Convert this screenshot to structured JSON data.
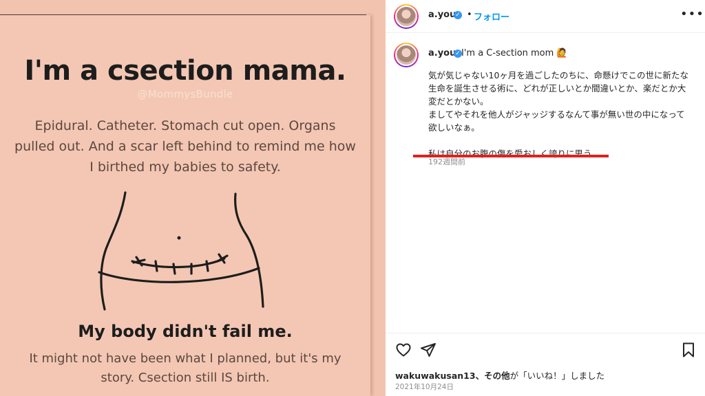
{
  "image": {
    "title": "I'm a csection mama.",
    "handle": "@MommysBundle",
    "body": "Epidural. Catheter. Stomach cut open. Organs pulled out. And a scar left behind to remind me how I birthed my babies to safety.",
    "tagline": "My body didn't fail me.",
    "footer": "It might not have been what I planned, but it's my story. Csection still IS birth."
  },
  "header": {
    "username": "a.you",
    "separator": "•",
    "follow_label": "フォロー",
    "more_icon": "ellipsis-icon"
  },
  "caption": {
    "username": "a.you",
    "title": "I'm a C-section mom 🙋",
    "text": "気が気じゃない10ヶ月を過ごしたのちに、命懸けでこの世に新たな生命を誕生させる術に、どれが正しいとか間違いとか、楽だとか大変だとかない。\nましてやそれを他人がジャッジするなんて事が無い世の中になって欲しいなぁ。\n\n私は自分のお腹の傷を愛おしく誇りに思う。",
    "timestamp": "192週間前",
    "highlight_color": "#e0201e"
  },
  "actions": {
    "like_icon": "heart-icon",
    "share_icon": "paper-plane-icon",
    "save_icon": "bookmark-icon",
    "likes_user": "wakuwakusan13",
    "likes_mid": "、その他",
    "likes_suffix": "が「いいね！」しました",
    "date": "2021年10月24日"
  },
  "colors": {
    "image_bg": "#f3c7b3",
    "link_blue": "#0095f6",
    "verified_blue": "#3897f0"
  }
}
